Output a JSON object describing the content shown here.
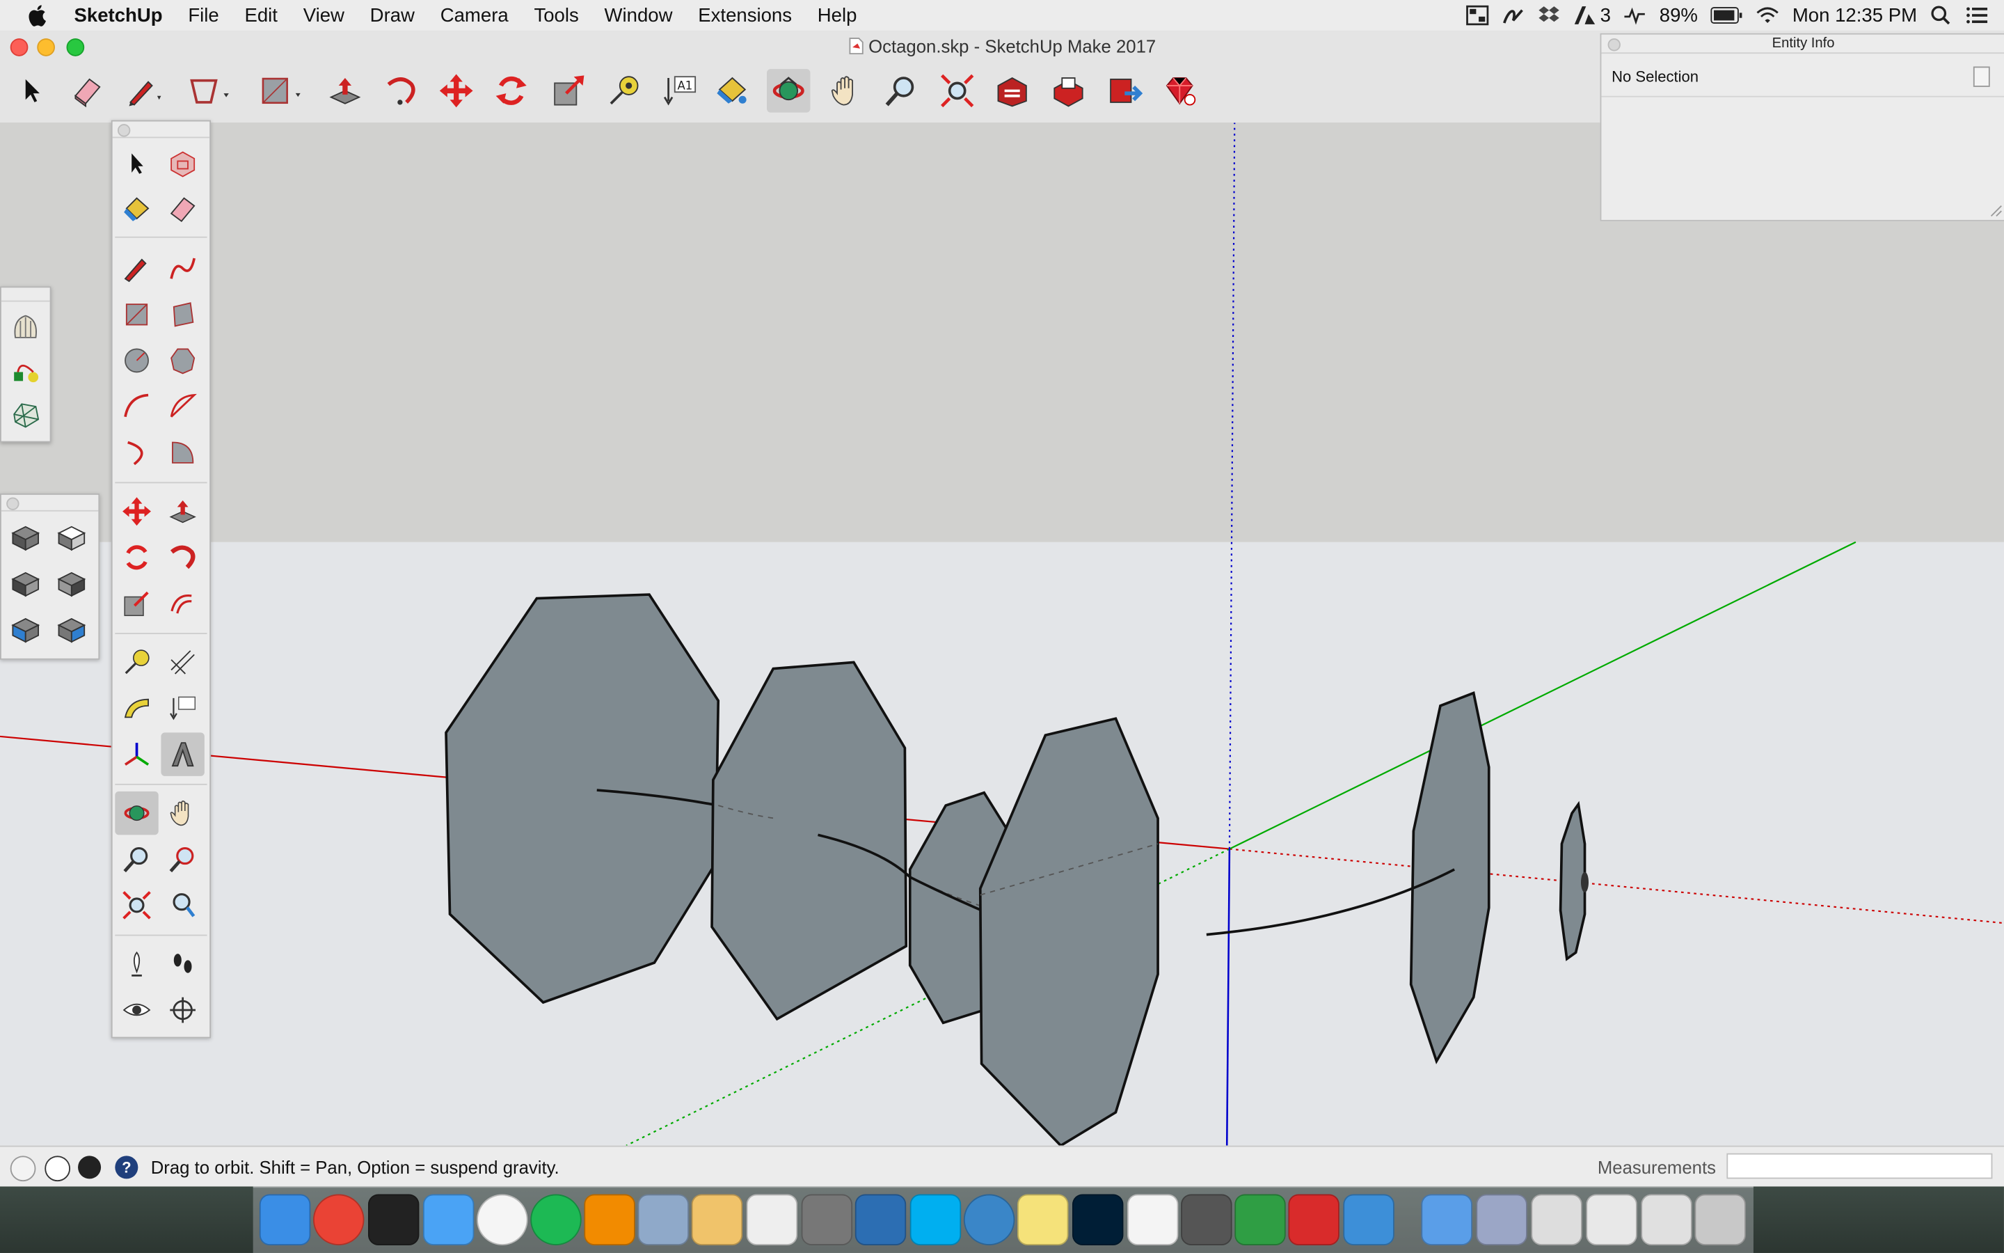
{
  "menubar": {
    "app_name": "SketchUp",
    "items": [
      "File",
      "Edit",
      "View",
      "Draw",
      "Camera",
      "Tools",
      "Window",
      "Extensions",
      "Help"
    ],
    "adobe_count": "3",
    "battery": "89%",
    "clock": "Mon 12:35 PM"
  },
  "window": {
    "title": "Octagon.skp - SketchUp Make 2017"
  },
  "entity_info": {
    "title": "Entity Info",
    "selection": "No Selection"
  },
  "statusbar": {
    "hint": "Drag to orbit. Shift = Pan, Option = suspend gravity.",
    "measurements_label": "Measurements",
    "measurements_value": ""
  },
  "label_tool_text": "A1",
  "colors": {
    "sky": "#d1d1cf",
    "ground": "#e3e5e8",
    "face": "#7f8a90",
    "red_axis": "#cc0000",
    "green_axis": "#00aa00",
    "blue_axis": "#0000cc"
  },
  "toolbar_tools": [
    "select-tool",
    "eraser-tool",
    "line-tool",
    "shape-tool",
    "rectangle-tool",
    "push-pull-tool",
    "follow-me-tool",
    "move-tool",
    "rotate-tool",
    "scale-tool",
    "tape-measure-tool",
    "text-tool",
    "paint-bucket-tool",
    "orbit-tool",
    "pan-tool",
    "zoom-tool",
    "zoom-extents-tool",
    "warehouse-tool",
    "share-model-tool",
    "extension-warehouse-tool",
    "ruby-tool"
  ],
  "dock_apps": [
    "finder",
    "chrome",
    "terminal",
    "messages",
    "itunes",
    "spotify",
    "vlc",
    "preview",
    "textedit",
    "pages",
    "system-preferences",
    "thunderbird",
    "skype",
    "safari",
    "stickies",
    "photoshop",
    "one-piece",
    "x11",
    "numbers",
    "sketchup",
    "xcode",
    "folder",
    "documents",
    "spreadsheet-1",
    "spreadsheet-2",
    "spreadsheet-3",
    "trash"
  ]
}
